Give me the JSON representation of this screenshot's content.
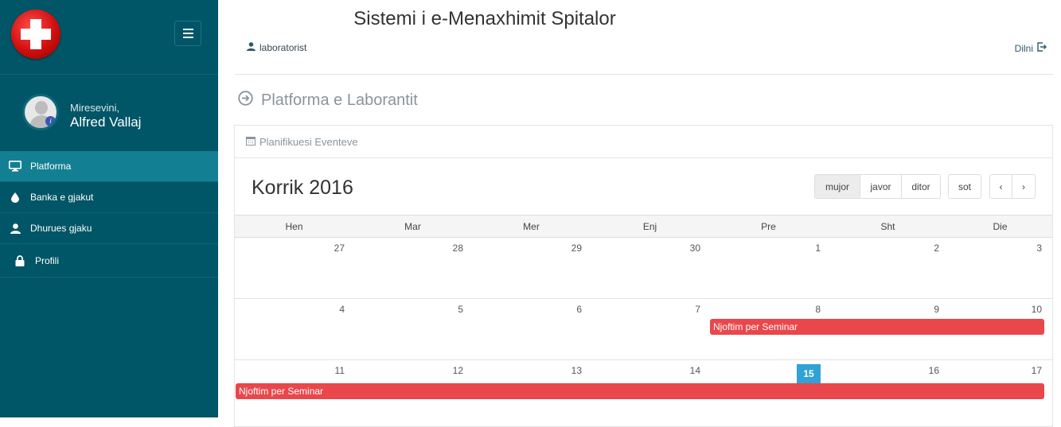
{
  "sidebar": {
    "welcome": "Miresevini,",
    "user_name": "Alfred Vallaj",
    "items": [
      {
        "label": "Platforma",
        "icon": "desktop-icon"
      },
      {
        "label": "Banka e gjakut",
        "icon": "blood-drop-icon"
      },
      {
        "label": "Dhurues gjaku",
        "icon": "user-icon"
      },
      {
        "label": "Profili",
        "icon": "lock-icon"
      }
    ]
  },
  "header": {
    "title": "Sistemi i e-Menaxhimit Spitalor",
    "user_link": "laboratorist",
    "logout": "Dilni"
  },
  "page": {
    "title": "Platforma e Laborantit"
  },
  "calendar": {
    "panel_title": "Planifikuesi Eventeve",
    "month_label": "Korrik 2016",
    "view_buttons": [
      "mujor",
      "javor",
      "ditor"
    ],
    "today_button": "sot",
    "prev_label": "‹",
    "next_label": "›",
    "weekdays": [
      "Hen",
      "Mar",
      "Mer",
      "Enj",
      "Pre",
      "Sht",
      "Die"
    ],
    "weeks": [
      [
        "27",
        "28",
        "29",
        "30",
        "1",
        "2",
        "3"
      ],
      [
        "4",
        "5",
        "6",
        "7",
        "8",
        "9",
        "10"
      ],
      [
        "11",
        "12",
        "13",
        "14",
        "15",
        "16",
        "17"
      ]
    ],
    "today": "15",
    "events": [
      {
        "title": "Njoftim per Seminar"
      },
      {
        "title": "Njoftim per Seminar"
      }
    ],
    "colors": {
      "event": "#e9474b",
      "today": "#31a2d6",
      "sidebar": "#005566",
      "active_nav": "#137f92"
    }
  }
}
